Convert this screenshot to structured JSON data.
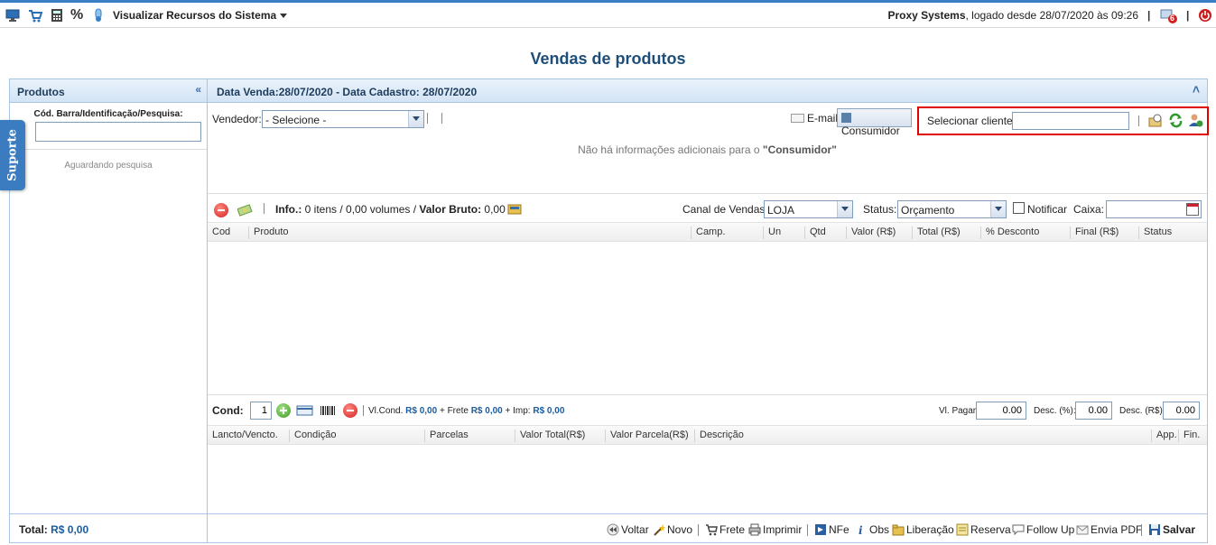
{
  "topbar": {
    "menu_title": "Visualizar Recursos do Sistema",
    "company": "Proxy Systems",
    "login_text": ", logado desde 28/07/2020 às 09:26",
    "notification_count": "6",
    "percent_glyph": "%"
  },
  "page_title": "Vendas de produtos",
  "left": {
    "header": "Produtos",
    "collapse_glyph": "«",
    "search_label": "Cód. Barra/Identificação/Pesquisa:",
    "search_value": "",
    "waiting_text": "Aguardando pesquisa",
    "total_label": "Total:",
    "total_value": "R$ 0,00",
    "support_tab": "Suporte"
  },
  "main": {
    "header": "Data Venda:28/07/2020 - Data Cadastro: 28/07/2020",
    "expand_glyph": "˄",
    "vendor_label": "Vendedor:",
    "vendor_value": "- Selecione -",
    "email_label": "E-mail",
    "consumer_label": "Consumidor",
    "select_client_label": "Selecionar cliente:",
    "select_client_value": "",
    "no_info_prefix": "Não há informações adicionais para o ",
    "no_info_target": "\"Consumidor\"",
    "info_label": "Info.:",
    "info_items": " 0 itens / 0,00 volumes / ",
    "gross_label": "Valor Bruto:",
    "gross_value": " 0,00",
    "channel_label": "Canal de Vendas:",
    "channel_value": "LOJA",
    "status_label": "Status:",
    "status_value": "Orçamento",
    "notify_label": "Notificar",
    "cashier_label": "Caixa:",
    "cashier_value": ""
  },
  "items_table": {
    "columns": [
      "Cod",
      "Produto",
      "Camp.",
      "Un",
      "Qtd",
      "Valor (R$)",
      "Total (R$)",
      "% Desconto",
      "Final (R$)",
      "Status"
    ]
  },
  "conditions": {
    "label": "Cond:",
    "count_value": "1",
    "vlcond_label": "Vl.Cond.",
    "vlcond_value": "R$ 0,00",
    "frete_label": "+ Frete",
    "frete_value": "R$ 0,00",
    "imp_label": "+ Imp:",
    "imp_value": "R$ 0,00",
    "pay_label": "Vl. Pagar:",
    "pay_value": "0.00",
    "disc_pct_label": "Desc. (%):",
    "disc_pct_value": "0.00",
    "disc_rs_label": "Desc. (R$):",
    "disc_rs_value": "0.00"
  },
  "conditions_table": {
    "columns": [
      "Lancto/Vencto.",
      "Condição",
      "Parcelas",
      "Valor Total(R$)",
      "Valor Parcela(R$)",
      "Descrição",
      "App.",
      "Fin."
    ]
  },
  "footer_buttons": {
    "voltar": "Voltar",
    "novo": "Novo",
    "frete": "Frete",
    "imprimir": "Imprimir",
    "nfe": "NFe",
    "obs": "Obs",
    "liberacao": "Liberação",
    "reserva": "Reserva",
    "follow_up": "Follow Up",
    "envia_pdf": "Envia PDF",
    "salvar": "Salvar"
  },
  "colors": {
    "accent": "#3a7fc6",
    "title": "#1d4e7a",
    "highlight_box": "#e00000",
    "money": "#1a5c9e"
  }
}
